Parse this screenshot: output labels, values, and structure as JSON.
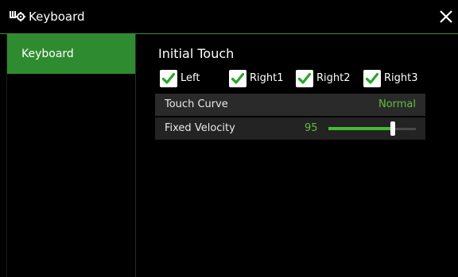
{
  "window": {
    "title": "Keyboard",
    "icon": "keyboard-settings-icon",
    "close_icon": "close-icon"
  },
  "sidebar": {
    "items": [
      {
        "label": "Keyboard",
        "active": true
      }
    ]
  },
  "main": {
    "section_title": "Initial Touch",
    "checkboxes": [
      {
        "label": "Left",
        "checked": true
      },
      {
        "label": "Right1",
        "checked": true
      },
      {
        "label": "Right2",
        "checked": true
      },
      {
        "label": "Right3",
        "checked": true
      }
    ],
    "touch_curve": {
      "label": "Touch Curve",
      "value": "Normal"
    },
    "fixed_velocity": {
      "label": "Fixed Velocity",
      "value": "95",
      "level": 0.74
    }
  },
  "colors": {
    "accent": "#2f8b2f",
    "value_text": "#5fbf3b",
    "slider_fill": "#3fbf2f"
  }
}
